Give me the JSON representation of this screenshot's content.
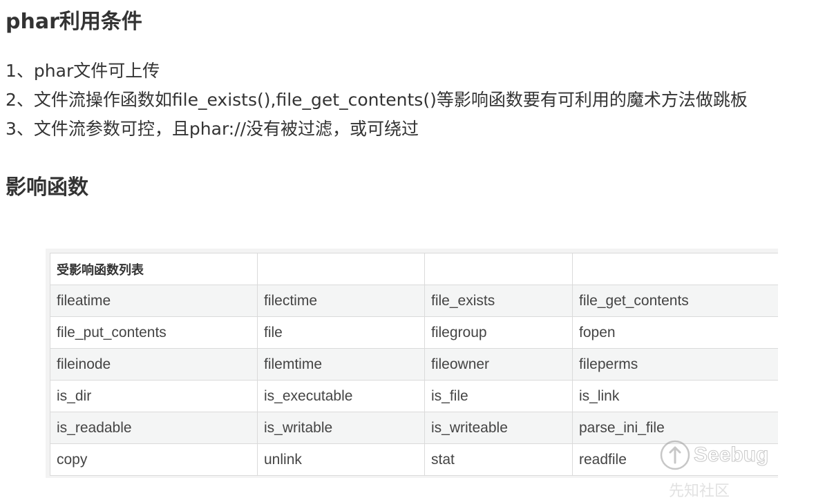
{
  "headings": {
    "conditions": "phar利用条件",
    "functions": "影响函数"
  },
  "conditions": [
    "1、phar文件可上传",
    "2、文件流操作函数如file_exists(),file_get_contents()等影响函数要有可利用的魔术方法做跳板",
    "3、文件流参数可控，且phar://没有被过滤，或可绕过"
  ],
  "table": {
    "header": [
      "受影响函数列表",
      "",
      "",
      ""
    ],
    "rows": [
      [
        "fileatime",
        "filectime",
        "file_exists",
        "file_get_contents"
      ],
      [
        "file_put_contents",
        "file",
        "filegroup",
        "fopen"
      ],
      [
        "fileinode",
        "filemtime",
        "fileowner",
        "fileperms"
      ],
      [
        "is_dir",
        "is_executable",
        "is_file",
        "is_link"
      ],
      [
        "is_readable",
        "is_writable",
        "is_writeable",
        "parse_ini_file"
      ],
      [
        "copy",
        "unlink",
        "stat",
        "readfile"
      ]
    ]
  },
  "watermark": {
    "brand": "Seebug",
    "community": "先知社区",
    "logo_icon": "seebug-logo-icon"
  }
}
